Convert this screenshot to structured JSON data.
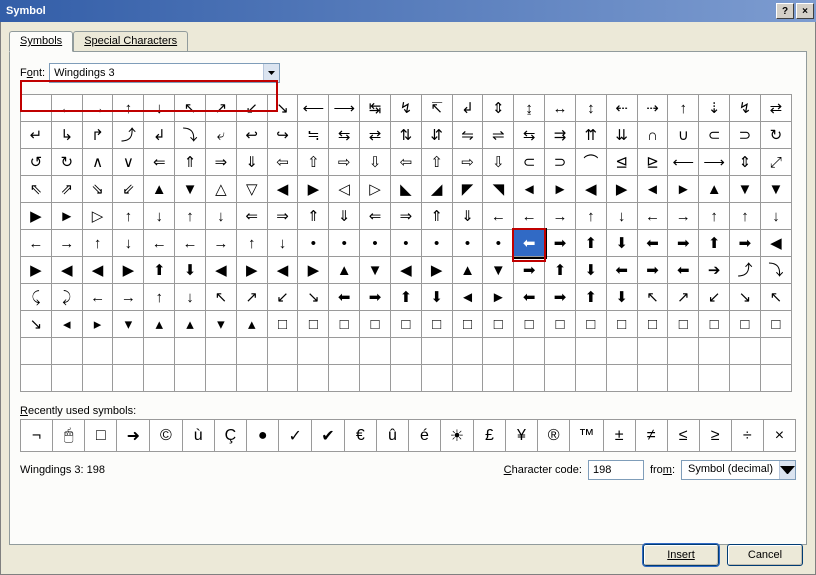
{
  "title": "Symbol",
  "tabs": {
    "symbols": "Symbols",
    "special": "Special Characters"
  },
  "font": {
    "label_pre": "F",
    "label_ul": "o",
    "label_post": "nt:",
    "value": "Wingdings 3"
  },
  "grid": [
    [
      "",
      "←",
      "→",
      "↑",
      "↓",
      "↖",
      "↗",
      "↙",
      "↘",
      "⟵",
      "⟶",
      "↹",
      "↯",
      "↸",
      "↲",
      "⇕",
      "↨",
      "↔",
      "↕",
      "⇠",
      "⇢",
      "↑",
      "⇣",
      "↯",
      "⇄"
    ],
    [
      "↵",
      "↳",
      "↱",
      "⤴",
      "↲",
      "⤵",
      "⤶",
      "↩",
      "↪",
      "≒",
      "⇆",
      "⇄",
      "⇅",
      "⇵",
      "⇋",
      "⇌",
      "⇆",
      "⇉",
      "⇈",
      "⇊",
      "∩",
      "∪",
      "⊂",
      "⊃",
      "↻"
    ],
    [
      "↺",
      "↻",
      "∧",
      "∨",
      "⇐",
      "⇑",
      "⇒",
      "⇓",
      "⇦",
      "⇧",
      "⇨",
      "⇩",
      "⇦",
      "⇧",
      "⇨",
      "⇩",
      "⊂",
      "⊃",
      "⌒",
      "⊴",
      "⊵",
      "⟵",
      "⟶",
      "⇕",
      "⤢"
    ],
    [
      "⇖",
      "⇗",
      "⇘",
      "⇙",
      "▲",
      "▼",
      "△",
      "▽",
      "◀",
      "▶",
      "◁",
      "▷",
      "◣",
      "◢",
      "◤",
      "◥",
      "◄",
      "►",
      "◀",
      "▶",
      "◄",
      "►",
      "▲",
      "▼",
      "▼"
    ],
    [
      "▶",
      "►",
      "▷",
      "↑",
      "↓",
      "↑",
      "↓",
      "⇐",
      "⇒",
      "⇑",
      "⇓",
      "⇐",
      "⇒",
      "⇑",
      "⇓",
      "←",
      "←",
      "→",
      "↑",
      "↓",
      "←",
      "→",
      "↑",
      "↑",
      "↓"
    ],
    [
      "←",
      "→",
      "↑",
      "↓",
      "←",
      "←",
      "→",
      "↑",
      "↓",
      "•",
      "•",
      "•",
      "•",
      "•",
      "•",
      "•",
      "⬅",
      "➡",
      "⬆",
      "⬇",
      "⬅",
      "➡",
      "⬆",
      "➡",
      "◀"
    ],
    [
      "▶",
      "◀",
      "◀",
      "▶",
      "⬆",
      "⬇",
      "◀",
      "▶",
      "◀",
      "▶",
      "▲",
      "▼",
      "◀",
      "▶",
      "▲",
      "▼",
      "➡",
      "⬆",
      "⬇",
      "⬅",
      "➡",
      "⬅",
      "➔",
      "⤴",
      "⤵"
    ],
    [
      "⤹",
      "⤸",
      "←",
      "→",
      "↑",
      "↓",
      "↖",
      "↗",
      "↙",
      "↘",
      "⬅",
      "➡",
      "⬆",
      "⬇",
      "◄",
      "►",
      "⬅",
      "➡",
      "⬆",
      "⬇",
      "↖",
      "↗",
      "↙",
      "↘",
      "↖"
    ],
    [
      "↘",
      "◂",
      "▸",
      "▾",
      "▴",
      "▴",
      "▾",
      "▴",
      "□",
      "□",
      "□",
      "□",
      "□",
      "□",
      "□",
      "□",
      "□",
      "□",
      "□",
      "□",
      "□",
      "□",
      "□",
      "□",
      "□"
    ]
  ],
  "selected": {
    "row": 5,
    "col": 16
  },
  "recent_label_pre": "",
  "recent_label_ul": "R",
  "recent_label_post": "ecently used symbols:",
  "recent": [
    "¬",
    "🖱",
    "□",
    "➜",
    "©",
    "ù",
    "Ç",
    "●",
    "✓",
    "✔",
    "€",
    "û",
    "é",
    "☀",
    "£",
    "¥",
    "®",
    "™",
    "±",
    "≠",
    "≤",
    "≥",
    "÷",
    "×"
  ],
  "status": "Wingdings 3: 198",
  "charcode": {
    "label_ul": "C",
    "label_post": "haracter code:",
    "value": "198"
  },
  "from": {
    "label_ul": "m",
    "label_pre": "fro",
    "label_post": ":",
    "value": "Symbol (decimal)"
  },
  "buttons": {
    "insert": "Insert",
    "cancel": "Cancel"
  }
}
